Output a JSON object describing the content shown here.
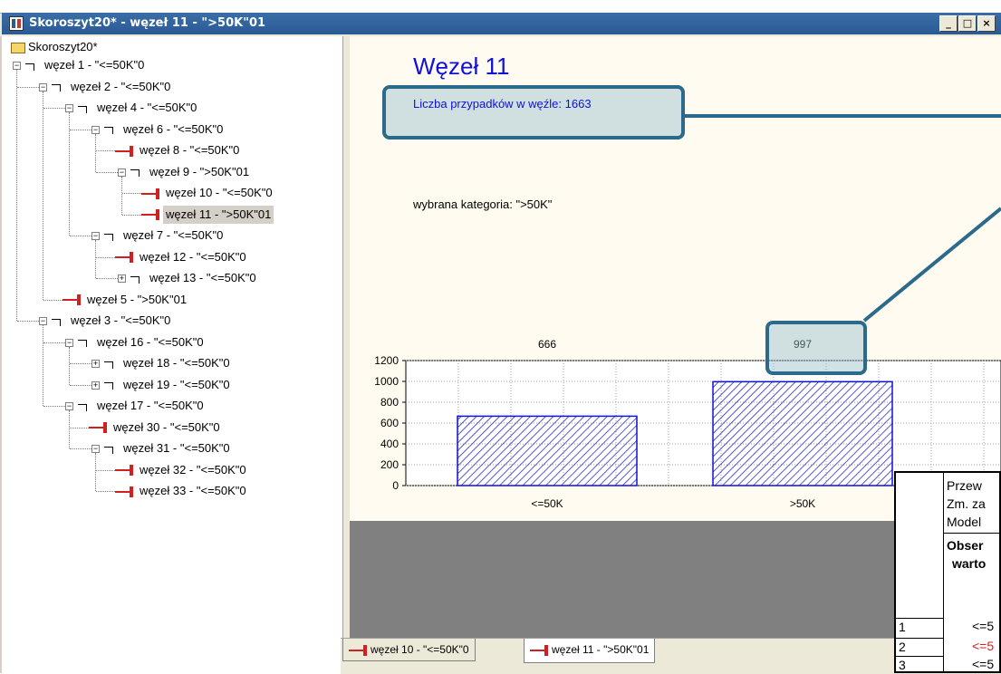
{
  "window": {
    "title": "Skoroszyt20* - węzeł 11 - \">50K\"01",
    "buttons": {
      "minimize": "_",
      "maximize": "□",
      "close": "×"
    }
  },
  "tree": {
    "root": "Skoroszyt20*",
    "nodes": [
      {
        "label": "węzeł 1 - \"<=50K\"0",
        "kind": "split",
        "toggle": "−"
      },
      {
        "label": "węzeł 2 - \"<=50K\"0",
        "kind": "split",
        "toggle": "−"
      },
      {
        "label": "węzeł 4 - \"<=50K\"0",
        "kind": "split",
        "toggle": "−"
      },
      {
        "label": "węzeł 6 - \"<=50K\"0",
        "kind": "split",
        "toggle": "−"
      },
      {
        "label": "węzeł 8 - \"<=50K\"0",
        "kind": "leaf"
      },
      {
        "label": "węzeł 9 - \">50K\"01",
        "kind": "split",
        "toggle": "−"
      },
      {
        "label": "węzeł 10 - \"<=50K\"0",
        "kind": "leaf"
      },
      {
        "label": "węzeł 11 - \">50K\"01",
        "kind": "leaf",
        "selected": true
      },
      {
        "label": "węzeł 7 - \"<=50K\"0",
        "kind": "split",
        "toggle": "−"
      },
      {
        "label": "węzeł 12 - \"<=50K\"0",
        "kind": "leaf"
      },
      {
        "label": "węzeł 13 - \"<=50K\"0",
        "kind": "split",
        "toggle": "+"
      },
      {
        "label": "węzeł 5 - \">50K\"01",
        "kind": "leaf"
      },
      {
        "label": "węzeł 3 - \"<=50K\"0",
        "kind": "split",
        "toggle": "−"
      },
      {
        "label": "węzeł 16 - \"<=50K\"0",
        "kind": "split",
        "toggle": "−"
      },
      {
        "label": "węzeł 18 - \"<=50K\"0",
        "kind": "split",
        "toggle": "+"
      },
      {
        "label": "węzeł 19 - \"<=50K\"0",
        "kind": "split",
        "toggle": "+"
      },
      {
        "label": "węzeł 17 - \"<=50K\"0",
        "kind": "split",
        "toggle": "−"
      },
      {
        "label": "węzeł 30 - \"<=50K\"0",
        "kind": "leaf"
      },
      {
        "label": "węzeł 31 - \"<=50K\"0",
        "kind": "split",
        "toggle": "−"
      },
      {
        "label": "węzeł 32 - \"<=50K\"0",
        "kind": "leaf"
      },
      {
        "label": "węzeł 33 - \"<=50K\"0",
        "kind": "leaf"
      }
    ]
  },
  "graph": {
    "heading": "Węzeł 11",
    "count_text": "Liczba przypadków w węźle: 1663",
    "category_text": "wybrana kategoria: \">50K\""
  },
  "chart_data": {
    "type": "bar",
    "categories": [
      "<=50K",
      ">50K"
    ],
    "values": [
      666,
      997
    ],
    "data_labels": [
      "666",
      "997"
    ],
    "yticks": [
      "0",
      "200",
      "400",
      "600",
      "800",
      "1000",
      "1200"
    ],
    "ylim": [
      0,
      1200
    ],
    "grid": true,
    "bar_fill": "#2020c8"
  },
  "tabs": [
    {
      "label": "węzeł 10 - \"<=50K\"0",
      "active": false
    },
    {
      "label": "węzeł 11 - \">50K\"01",
      "active": true
    }
  ],
  "spreadsheet": {
    "header_lines": [
      "Przew",
      "Zm. za",
      "Model"
    ],
    "bold_header": [
      "Obser",
      "warto"
    ],
    "rows": [
      {
        "num": "1",
        "value": "<=5",
        "color": "#000000"
      },
      {
        "num": "2",
        "value": "<=5",
        "color": "#d02020"
      },
      {
        "num": "3",
        "value": "<=5",
        "color": "#000000"
      }
    ]
  },
  "colors": {
    "accent": "#1010d8",
    "callout": "#2b6a8a",
    "leaf": "#d02020"
  }
}
